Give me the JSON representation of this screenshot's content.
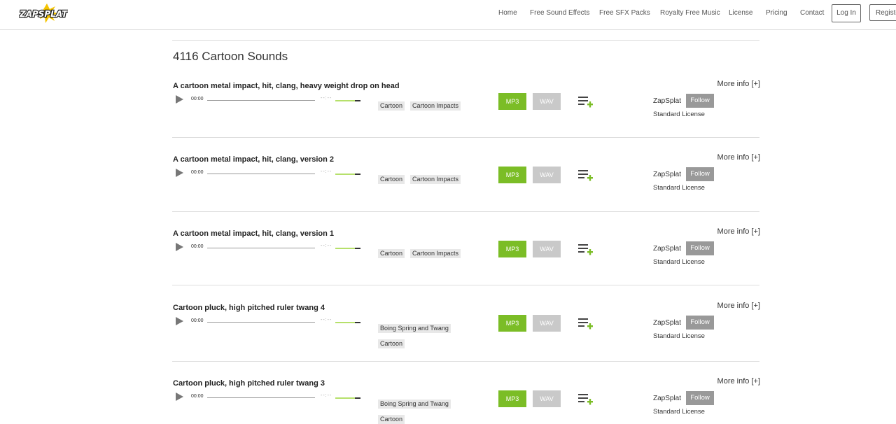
{
  "header": {
    "logo_text": "ZAPSPLAT",
    "nav": [
      "Home",
      "Free Sound Effects",
      "Free SFX Packs",
      "Royalty Free Music",
      "License",
      "Pricing",
      "Contact"
    ],
    "login_label": "Log In",
    "register_label": "Registe"
  },
  "page": {
    "title": "4116 Cartoon Sounds",
    "more_info_label": "More info [+]",
    "mp3_label": "MP3",
    "wav_label": "WAV",
    "follow_label": "Follow",
    "time_label": "00:00",
    "duration_placeholder": "--:--"
  },
  "sounds": [
    {
      "title": "A cartoon metal impact, hit, clang, heavy weight drop on head",
      "tags": [
        "Cartoon",
        "Cartoon Impacts"
      ],
      "author": "ZapSplat",
      "license": "Standard License"
    },
    {
      "title": "A cartoon metal impact, hit, clang, version 2",
      "tags": [
        "Cartoon",
        "Cartoon Impacts"
      ],
      "author": "ZapSplat",
      "license": "Standard License"
    },
    {
      "title": "A cartoon metal impact, hit, clang, version 1",
      "tags": [
        "Cartoon",
        "Cartoon Impacts"
      ],
      "author": "ZapSplat",
      "license": "Standard License"
    },
    {
      "title": "Cartoon pluck, high pitched ruler twang 4",
      "tags": [
        "Boing Spring and Twang",
        "Cartoon"
      ],
      "author": "ZapSplat",
      "license": "Standard License"
    },
    {
      "title": "Cartoon pluck, high pitched ruler twang 3",
      "tags": [
        "Boing Spring and Twang",
        "Cartoon"
      ],
      "author": "ZapSplat",
      "license": "Standard License"
    }
  ],
  "colors": {
    "mp3": "#7bbd26",
    "wav": "#c9c9c9",
    "follow": "#999999",
    "logo_yellow": "#f5c400"
  }
}
